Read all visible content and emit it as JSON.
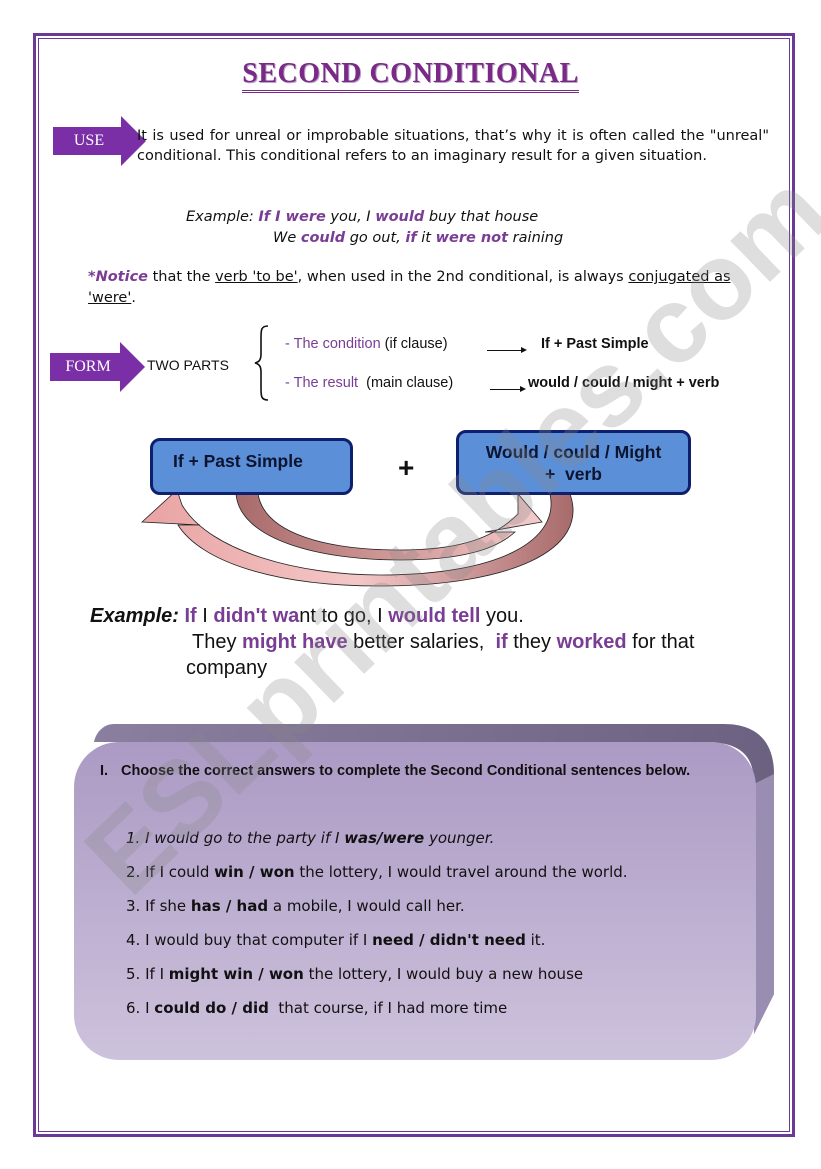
{
  "page": {
    "title": "SECOND CONDITIONAL",
    "border_color": "#6a3a96",
    "accent_color": "#7a3d94",
    "watermark": "ESLprintables.com"
  },
  "use": {
    "tag": "USE",
    "text": "It is used for unreal or improbable situations, that’s why it is often called the \"unreal\" conditional. This conditional refers to an imaginary result for a given situation."
  },
  "use_example": {
    "label": "Example:",
    "line1": [
      {
        "t": " ",
        "s": "n"
      },
      {
        "t": "If I were",
        "s": "b"
      },
      {
        "t": " you, I ",
        "s": "n"
      },
      {
        "t": "would",
        "s": "b"
      },
      {
        "t": " buy that house",
        "s": "n"
      }
    ],
    "line2": [
      {
        "t": "We ",
        "s": "n"
      },
      {
        "t": "could",
        "s": "b"
      },
      {
        "t": " go out, ",
        "s": "n"
      },
      {
        "t": "if",
        "s": "b"
      },
      {
        "t": " it ",
        "s": "n"
      },
      {
        "t": "were not",
        "s": "b"
      },
      {
        "t": " raining",
        "s": "n"
      }
    ]
  },
  "notice": {
    "prefix": "*Notice",
    "part1": " that the ",
    "underlined1": "verb 'to be'",
    "part2": ", when used in the 2nd conditional, is always ",
    "underlined2": "conjugated as 'were'",
    "part3": "."
  },
  "form": {
    "tag": "FORM",
    "label": "TWO PARTS",
    "brace": "{",
    "condition_label": "- The condition",
    "condition_clause": " (if clause)",
    "condition_result": "If + Past Simple",
    "result_label": "- The result",
    "result_clause": "  (main clause)",
    "result_result": "would / could / might + verb"
  },
  "diagram": {
    "box_left": "If + Past Simple",
    "plus": "+",
    "box_right_line1": "Would / could / Might",
    "box_right_line2": "+  verb",
    "box_color": "#5b8fd8",
    "box_border": "#0e1f6e",
    "arrow_color": "#d89a9a"
  },
  "example2": {
    "label": "Example:",
    "line1": [
      {
        "t": " ",
        "s": "n"
      },
      {
        "t": "If",
        "s": "b"
      },
      {
        "t": " I ",
        "s": "n"
      },
      {
        "t": "didn't wa",
        "s": "b"
      },
      {
        "t": "nt to go, I ",
        "s": "n"
      },
      {
        "t": "would tell",
        "s": "b"
      },
      {
        "t": " you.",
        "s": "n"
      }
    ],
    "line2": [
      {
        "t": "They ",
        "s": "n"
      },
      {
        "t": "might have",
        "s": "b"
      },
      {
        "t": " better salaries,  ",
        "s": "n"
      },
      {
        "t": "if",
        "s": "b"
      },
      {
        "t": " they ",
        "s": "n"
      },
      {
        "t": "worked",
        "s": "b"
      },
      {
        "t": " for that",
        "s": "n"
      }
    ],
    "line3": "company"
  },
  "exercise": {
    "number": "I.",
    "instruction": "Choose the correct answers to complete the Second Conditional sentences below.",
    "panel_color": "#b6a6cc",
    "items": [
      {
        "n": "1.",
        "italic": true,
        "parts": [
          {
            "t": "I would go to the party if I ",
            "b": false
          },
          {
            "t": "was/were",
            "b": true
          },
          {
            "t": " younger.",
            "b": false
          }
        ]
      },
      {
        "n": "2.",
        "italic": false,
        "parts": [
          {
            "t": "If I could ",
            "b": false
          },
          {
            "t": "win / won",
            "b": true
          },
          {
            "t": " the lottery, I would travel around the world.",
            "b": false
          }
        ]
      },
      {
        "n": "3.",
        "italic": false,
        "parts": [
          {
            "t": "If she ",
            "b": false
          },
          {
            "t": "has / had",
            "b": true
          },
          {
            "t": " a mobile, I would call her.",
            "b": false
          }
        ]
      },
      {
        "n": "4.",
        "italic": false,
        "parts": [
          {
            "t": "I would buy that computer if I ",
            "b": false
          },
          {
            "t": "need / didn't need",
            "b": true
          },
          {
            "t": " it.",
            "b": false
          }
        ]
      },
      {
        "n": "5.",
        "italic": false,
        "parts": [
          {
            "t": "If I ",
            "b": false
          },
          {
            "t": "might win / won",
            "b": true
          },
          {
            "t": " the lottery, I would buy a new house",
            "b": false
          }
        ]
      },
      {
        "n": "6.",
        "italic": false,
        "parts": [
          {
            "t": "I ",
            "b": false
          },
          {
            "t": "could do / did",
            "b": true
          },
          {
            "t": "  that course, if I had more time",
            "b": false
          }
        ]
      }
    ]
  }
}
